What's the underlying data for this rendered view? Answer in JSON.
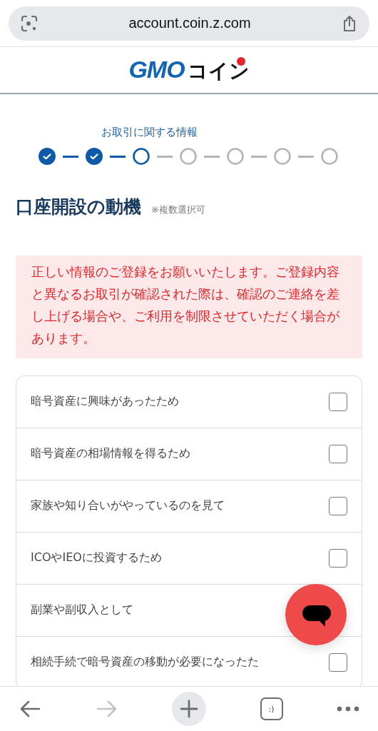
{
  "browser": {
    "url": "account.coin.z.com"
  },
  "logo": {
    "brand": "GMO",
    "suffix": "コイン"
  },
  "stepper": {
    "label": "お取引に関する情報",
    "steps": [
      {
        "kind": "done"
      },
      {
        "kind": "done"
      },
      {
        "kind": "current"
      },
      {
        "kind": "pending"
      },
      {
        "kind": "pending"
      },
      {
        "kind": "pending"
      },
      {
        "kind": "pending"
      }
    ]
  },
  "heading": {
    "title": "口座開設の動機",
    "note": "※複数選択可"
  },
  "alert": "正しい情報のご登録をお願いいたします。ご登録内容と異なるお取引が確認された際は、確認のご連絡を差し上げる場合や、ご利用を制限させていただく場合があります。",
  "options": [
    {
      "label": "暗号資産に興味があったため",
      "checked": false
    },
    {
      "label": "暗号資産の相場情報を得るため",
      "checked": false
    },
    {
      "label": "家族や知り合いがやっているのを見て",
      "checked": false
    },
    {
      "label": "ICOやIEOに投資するため",
      "checked": false
    },
    {
      "label": "副業や副収入として"
    },
    {
      "label": "相続手続で暗号資産の移動が必要になったた",
      "checked": false
    }
  ],
  "toolbar": {
    "forward_disabled": true,
    "tabs_label": ":)"
  }
}
